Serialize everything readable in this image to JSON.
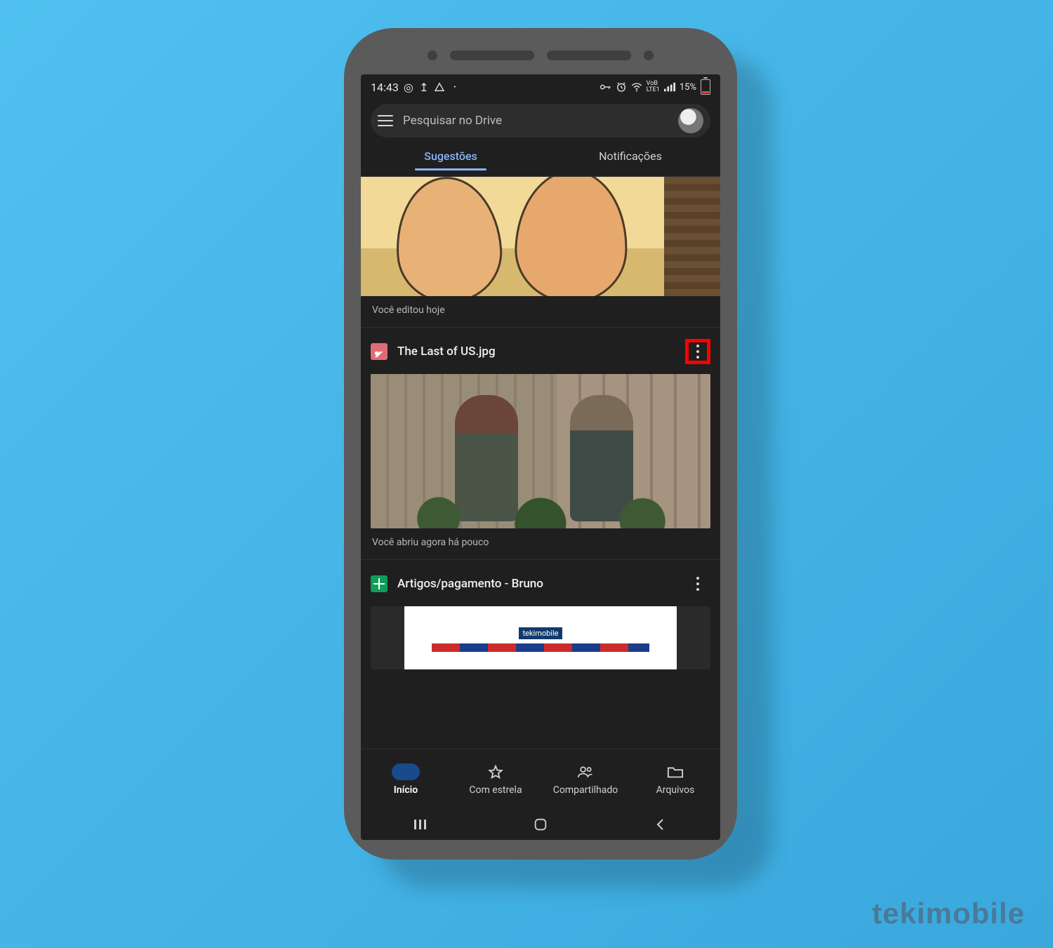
{
  "watermark": "tekimobile",
  "status": {
    "time": "14:43",
    "icons_left": [
      "screenshot",
      "upload",
      "cloud",
      "dot"
    ],
    "icons_right": [
      "vpn-key",
      "alarm",
      "wifi",
      "volte",
      "signal"
    ],
    "battery_text": "15%"
  },
  "search": {
    "placeholder": "Pesquisar no Drive"
  },
  "tabs": {
    "suggestions": "Sugestões",
    "notifications": "Notificações",
    "active": "suggestions"
  },
  "cards": [
    {
      "id": "card1",
      "caption": "Você editou hoje"
    },
    {
      "id": "card2",
      "file_type": "image",
      "title": "The Last of US.jpg",
      "caption": "Você abriu agora há pouco",
      "more_highlighted": true
    },
    {
      "id": "card3",
      "file_type": "sheet",
      "title": "Artigos/pagamento - Bruno",
      "doc_logo": "tekimobile"
    }
  ],
  "bottom_nav": {
    "home": "Início",
    "starred": "Com estrela",
    "shared": "Compartilhado",
    "files": "Arquivos"
  }
}
